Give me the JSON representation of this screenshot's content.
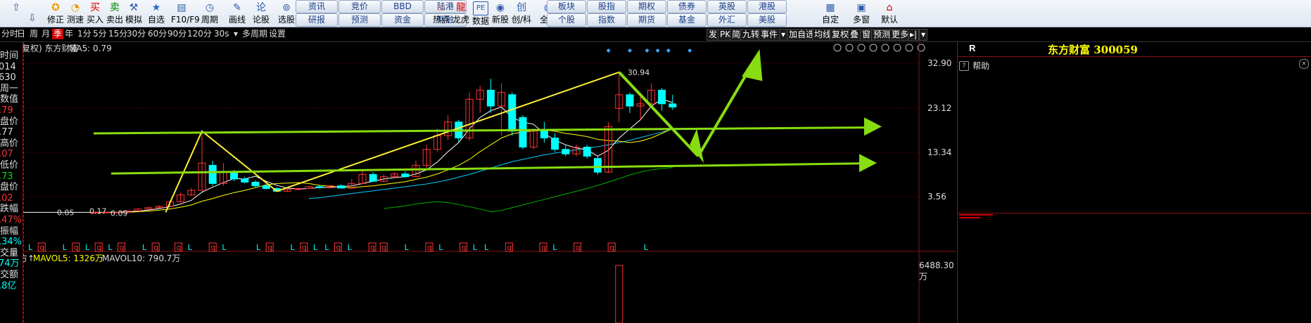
{
  "toolbar": {
    "left_buttons": [
      {
        "name": "up",
        "label": "",
        "icon": "up-arrow-icon"
      },
      {
        "name": "repair",
        "label": "修正",
        "icon": "repair-icon"
      },
      {
        "name": "speed",
        "label": "测速",
        "icon": "speed-icon"
      },
      {
        "name": "buy",
        "label": "买入",
        "icon": "buy-icon"
      },
      {
        "name": "sell",
        "label": "卖出",
        "icon": "sell-icon"
      },
      {
        "name": "simulate",
        "label": "模拟",
        "icon": "simulate-icon"
      },
      {
        "name": "custom",
        "label": "自选",
        "icon": "star-icon"
      },
      {
        "name": "f10",
        "label": "F10/F9",
        "icon": "f10-icon"
      },
      {
        "name": "period",
        "label": "周期",
        "icon": "clock-icon"
      },
      {
        "name": "draw",
        "label": "画线",
        "icon": "pencil-icon"
      },
      {
        "name": "forum",
        "label": "论股",
        "icon": "forum-icon"
      },
      {
        "name": "select",
        "label": "选股",
        "icon": "select-icon"
      }
    ],
    "pills_row1": [
      "资讯",
      "竞价",
      "BBD",
      "陆港"
    ],
    "pills_row2": [
      "研报",
      "预测",
      "资金",
      "两融"
    ],
    "mid_buttons": [
      {
        "label": "热点",
        "icon": "hot-icon"
      },
      {
        "label": "龙虎",
        "icon": "dragon-icon"
      },
      {
        "label": "数据",
        "icon": "pe-icon",
        "icontext": "PE"
      },
      {
        "label": "新股",
        "icon": "new-stock-icon"
      },
      {
        "label": "创/科",
        "icon": "innovation-icon"
      },
      {
        "label": "全球",
        "icon": "globe-icon"
      }
    ],
    "pills2_row1": [
      "板块",
      "股指",
      "期权",
      "债券",
      "英股",
      "港股"
    ],
    "pills2_row2": [
      "个股",
      "指数",
      "期货",
      "基金",
      "外汇",
      "美股"
    ],
    "right_buttons": [
      {
        "label": "自定",
        "icon": "custom-define-icon"
      },
      {
        "label": "多窗",
        "icon": "multi-window-icon"
      },
      {
        "label": "默认",
        "icon": "home-icon"
      }
    ]
  },
  "periodbar": {
    "items": [
      "分时",
      "日",
      "周",
      "月",
      "季",
      "年",
      "1分",
      "5分",
      "15分",
      "30分",
      "60分",
      "90分",
      "120分",
      "30s",
      "▾",
      "多周期",
      "设置"
    ],
    "selected": "季",
    "right_items": [
      "发",
      "PK",
      "简",
      "九转",
      "事件",
      "▾",
      "加自选",
      "均线",
      "复权",
      "叠",
      "窗",
      "预测",
      "更多",
      "▸|",
      "▾"
    ]
  },
  "leftcol": {
    "lines": [
      {
        "text": "时间",
        "color": "#ddd"
      },
      {
        "text": "014",
        "color": "#ddd"
      },
      {
        "text": "630",
        "color": "#ddd"
      },
      {
        "text": "周一",
        "color": "#ddd"
      },
      {
        "text": "数值",
        "color": "#ddd"
      },
      {
        "text": ".79",
        "color": "#ff3333"
      },
      {
        "text": "盘价",
        "color": "#ddd"
      },
      {
        "text": ".77",
        "color": "#ddd"
      },
      {
        "text": "高价",
        "color": "#ddd"
      },
      {
        "text": ".07",
        "color": "#ff3333"
      },
      {
        "text": "低价",
        "color": "#ddd"
      },
      {
        "text": ".73",
        "color": "#00e000"
      },
      {
        "text": "盘价",
        "color": "#ddd"
      },
      {
        "text": ".02",
        "color": "#ff3333"
      },
      {
        "text": "跌幅",
        "color": "#ddd"
      },
      {
        "text": ".47%",
        "color": "#ff3333"
      },
      {
        "text": "振幅",
        "color": "#ddd"
      },
      {
        "text": ".34%",
        "color": "#00ffff"
      },
      {
        "text": "交量",
        "color": "#ddd"
      },
      {
        "text": "74万",
        "color": "#00ffff"
      },
      {
        "text": "交额",
        "color": "#ddd"
      },
      {
        "text": ".8亿",
        "color": "#00ffff"
      }
    ]
  },
  "chart_header": {
    "label": "复权) 东方财富",
    "ma5": "MA5: 0.79",
    "ma5_color": "#dddddd"
  },
  "right_panel": {
    "code_prefix": "R",
    "title": "东方财富 300059",
    "help": "帮助"
  },
  "volume_header": {
    "mavol5": "MAVOL5: 1326万",
    "mavol10": "MAVOL10: 790.7万"
  },
  "colors": {
    "up": "#ff3333",
    "down": "#00ffff",
    "ma_white": "#ffffff",
    "ma_yellow": "#ffff00",
    "ma_cyan": "#00d0ff",
    "ma_green": "#00b000",
    "annotation_green": "#88dd11",
    "annotation_yellow": "#ffee33",
    "event_red": "#ff3333",
    "event_cyan": "#00ffff"
  },
  "chart_data": {
    "type": "candlestick",
    "title": "东方财富",
    "yaxis_ticks": [
      32.9,
      23.12,
      13.34,
      3.56
    ],
    "volume_axis_tick": "6488.30万",
    "y_range": [
      -1.0,
      36.0
    ],
    "high_label": "30.94",
    "price_labels": [
      "0.05",
      "0.17",
      "0.09"
    ],
    "candles": [
      {
        "i": 0,
        "o": 0.17,
        "c": 0.18,
        "h": 0.2,
        "l": 0.15
      },
      {
        "i": 1,
        "o": 0.18,
        "c": 0.19,
        "h": 0.21,
        "l": 0.16
      },
      {
        "i": 2,
        "o": 0.19,
        "c": 0.2,
        "h": 0.22,
        "l": 0.17
      },
      {
        "i": 3,
        "o": 0.2,
        "c": 0.5,
        "h": 0.6,
        "l": 0.18
      },
      {
        "i": 4,
        "o": 0.5,
        "c": 0.9,
        "h": 1.0,
        "l": 0.45
      },
      {
        "i": 5,
        "o": 0.9,
        "c": 1.2,
        "h": 1.3,
        "l": 0.85
      },
      {
        "i": 6,
        "o": 1.2,
        "c": 1.5,
        "h": 1.7,
        "l": 1.1
      },
      {
        "i": 7,
        "o": 1.5,
        "c": 2.5,
        "h": 2.8,
        "l": 1.4
      },
      {
        "i": 8,
        "o": 2.5,
        "c": 4.0,
        "h": 4.5,
        "l": 2.3
      },
      {
        "i": 9,
        "o": 4.0,
        "c": 5.0,
        "h": 5.5,
        "l": 3.8
      },
      {
        "i": 10,
        "o": 5.0,
        "c": 11.0,
        "h": 18.0,
        "l": 4.8
      },
      {
        "i": 11,
        "o": 10.5,
        "c": 6.5,
        "h": 11.5,
        "l": 6.0
      },
      {
        "i": 12,
        "o": 6.5,
        "c": 9.0,
        "h": 11.0,
        "l": 6.0
      },
      {
        "i": 13,
        "o": 9.0,
        "c": 7.5,
        "h": 9.5,
        "l": 7.0
      },
      {
        "i": 14,
        "o": 7.5,
        "c": 6.8,
        "h": 8.0,
        "l": 6.5
      },
      {
        "i": 15,
        "o": 6.8,
        "c": 6.0,
        "h": 7.2,
        "l": 5.6
      },
      {
        "i": 16,
        "o": 6.0,
        "c": 5.4,
        "h": 6.3,
        "l": 5.2
      },
      {
        "i": 17,
        "o": 5.4,
        "c": 4.8,
        "h": 5.7,
        "l": 4.6
      },
      {
        "i": 18,
        "o": 4.8,
        "c": 5.2,
        "h": 5.4,
        "l": 4.6
      },
      {
        "i": 19,
        "o": 5.2,
        "c": 5.4,
        "h": 5.6,
        "l": 5.0
      },
      {
        "i": 20,
        "o": 5.4,
        "c": 5.8,
        "h": 6.0,
        "l": 5.3
      },
      {
        "i": 21,
        "o": 5.8,
        "c": 5.6,
        "h": 6.2,
        "l": 5.4
      },
      {
        "i": 22,
        "o": 5.6,
        "c": 6.0,
        "h": 6.2,
        "l": 5.5
      },
      {
        "i": 23,
        "o": 6.0,
        "c": 5.5,
        "h": 6.3,
        "l": 5.4
      },
      {
        "i": 24,
        "o": 5.5,
        "c": 6.5,
        "h": 7.5,
        "l": 5.4
      },
      {
        "i": 25,
        "o": 6.5,
        "c": 8.5,
        "h": 9.5,
        "l": 6.3
      },
      {
        "i": 26,
        "o": 8.5,
        "c": 7.0,
        "h": 9.0,
        "l": 6.8
      },
      {
        "i": 27,
        "o": 7.0,
        "c": 8.0,
        "h": 8.5,
        "l": 6.8
      },
      {
        "i": 28,
        "o": 8.0,
        "c": 8.6,
        "h": 9.0,
        "l": 7.8
      },
      {
        "i": 29,
        "o": 8.6,
        "c": 8.0,
        "h": 9.2,
        "l": 7.8
      },
      {
        "i": 30,
        "o": 8.0,
        "c": 10.5,
        "h": 11.5,
        "l": 7.9
      },
      {
        "i": 31,
        "o": 10.5,
        "c": 14.0,
        "h": 15.0,
        "l": 10.0
      },
      {
        "i": 32,
        "o": 14.0,
        "c": 17.0,
        "h": 18.5,
        "l": 13.5
      },
      {
        "i": 33,
        "o": 17.0,
        "c": 20.0,
        "h": 21.5,
        "l": 16.0
      },
      {
        "i": 34,
        "o": 20.0,
        "c": 16.5,
        "h": 20.5,
        "l": 15.5
      },
      {
        "i": 35,
        "o": 16.5,
        "c": 25.0,
        "h": 26.5,
        "l": 16.0
      },
      {
        "i": 36,
        "o": 25.0,
        "c": 27.0,
        "h": 28.0,
        "l": 22.0
      },
      {
        "i": 37,
        "o": 27.0,
        "c": 23.5,
        "h": 29.5,
        "l": 22.0
      },
      {
        "i": 38,
        "o": 23.5,
        "c": 26.5,
        "h": 28.5,
        "l": 17.0
      },
      {
        "i": 39,
        "o": 26.0,
        "c": 18.0,
        "h": 26.5,
        "l": 17.0
      },
      {
        "i": 40,
        "o": 21.0,
        "c": 14.5,
        "h": 21.5,
        "l": 14.0
      },
      {
        "i": 41,
        "o": 14.5,
        "c": 18.0,
        "h": 18.5,
        "l": 14.0
      },
      {
        "i": 42,
        "o": 18.0,
        "c": 16.5,
        "h": 20.0,
        "l": 15.5
      },
      {
        "i": 43,
        "o": 16.5,
        "c": 14.0,
        "h": 17.5,
        "l": 13.5
      },
      {
        "i": 44,
        "o": 14.0,
        "c": 13.0,
        "h": 15.0,
        "l": 12.5
      },
      {
        "i": 45,
        "o": 13.0,
        "c": 14.5,
        "h": 15.0,
        "l": 12.5
      },
      {
        "i": 46,
        "o": 14.5,
        "c": 12.5,
        "h": 15.0,
        "l": 12.0
      },
      {
        "i": 47,
        "o": 12.0,
        "c": 9.0,
        "h": 12.5,
        "l": 8.5
      },
      {
        "i": 48,
        "o": 9.0,
        "c": 19.0,
        "h": 20.0,
        "l": 8.8
      },
      {
        "i": 49,
        "o": 23.0,
        "c": 26.0,
        "h": 30.94,
        "l": 20.0
      },
      {
        "i": 50,
        "o": 26.0,
        "c": 23.5,
        "h": 26.5,
        "l": 22.0
      },
      {
        "i": 51,
        "o": 23.5,
        "c": 24.0,
        "h": 25.5,
        "l": 20.5
      },
      {
        "i": 52,
        "o": 24.0,
        "c": 27.0,
        "h": 28.5,
        "l": 23.5
      },
      {
        "i": 53,
        "o": 27.0,
        "c": 24.0,
        "h": 27.5,
        "l": 22.5
      },
      {
        "i": 54,
        "o": 24.0,
        "c": 23.3,
        "h": 26.0,
        "l": 22.7
      }
    ],
    "ma5": [
      0.17,
      0.18,
      0.19,
      0.27,
      0.42,
      0.68,
      1.0,
      1.4,
      2.0,
      2.8,
      4.6,
      5.7,
      6.7,
      7.6,
      7.5,
      8.1,
      7.0,
      6.1,
      5.5,
      5.3,
      5.4,
      5.6,
      5.7,
      5.8,
      6.0,
      6.5,
      7.0,
      7.5,
      7.8,
      8.0,
      8.6,
      9.5,
      11.2,
      13.5,
      15.5,
      18.5,
      21.0,
      22.5,
      23.3,
      21.0,
      20.0,
      19.5,
      17.5,
      16.0,
      15.0,
      14.3,
      13.9,
      12.5,
      13.8,
      16.5,
      18.5,
      20.5,
      23.5,
      25.0,
      24.3
    ],
    "ma10": [
      0.17,
      0.17,
      0.18,
      0.2,
      0.3,
      0.45,
      0.65,
      0.9,
      1.3,
      1.8,
      2.6,
      3.2,
      3.9,
      4.5,
      5.0,
      5.6,
      6.2,
      6.5,
      6.6,
      6.7,
      6.5,
      6.1,
      5.9,
      5.7,
      5.6,
      5.8,
      6.0,
      6.3,
      6.6,
      6.9,
      7.4,
      7.9,
      8.6,
      9.5,
      10.5,
      11.8,
      13.5,
      15.0,
      16.5,
      17.4,
      17.8,
      18.0,
      18.2,
      18.0,
      17.5,
      17.2,
      16.8,
      16.2,
      15.9,
      15.8,
      15.5,
      15.8,
      16.5,
      17.5,
      18.6
    ],
    "ma20": [
      null,
      null,
      null,
      null,
      null,
      null,
      null,
      null,
      null,
      null,
      null,
      null,
      null,
      null,
      null,
      null,
      null,
      null,
      null,
      null,
      3.2,
      3.4,
      3.7,
      4.0,
      4.3,
      4.6,
      4.9,
      5.2,
      5.5,
      5.8,
      6.1,
      6.4,
      6.8,
      7.3,
      7.9,
      8.5,
      9.2,
      9.9,
      10.6,
      11.3,
      11.8,
      12.3,
      12.8,
      13.2,
      13.5,
      13.9,
      14.3,
      14.6,
      15.0,
      15.5,
      16.0,
      16.6,
      17.2,
      17.8,
      18.4
    ],
    "ma60": [
      null,
      null,
      null,
      null,
      null,
      null,
      null,
      null,
      null,
      null,
      null,
      null,
      null,
      null,
      null,
      null,
      null,
      null,
      null,
      null,
      null,
      null,
      null,
      null,
      null,
      null,
      null,
      1.0,
      1.3,
      1.6,
      2.0,
      2.3,
      2.5,
      2.3,
      1.9,
      1.4,
      0.9,
      0.3,
      0.6,
      1.2,
      1.8,
      2.4,
      3.0,
      3.6,
      4.2,
      4.8,
      5.4,
      6.1,
      6.8,
      7.6,
      8.4,
      9.0,
      9.5,
      9.8,
      10.0
    ],
    "event_row": [
      "L",
      "q",
      "",
      "L",
      "q",
      "L",
      "q",
      "L",
      "q",
      "",
      "L",
      "q",
      "",
      "q",
      "L",
      "",
      "q",
      "L",
      "",
      "",
      "L",
      "q",
      "",
      "L",
      "q",
      "L",
      "L",
      "q",
      "L",
      "",
      "q",
      "q",
      "",
      "L",
      "",
      "q",
      "L",
      "",
      "q",
      "L",
      "L",
      "",
      "q",
      "",
      "",
      "q",
      "L",
      "",
      "q",
      "",
      "",
      "q",
      "",
      "",
      "L"
    ],
    "volume_visible_bar_index": 49,
    "annotations": "trend lines and arrows drawn by user"
  }
}
